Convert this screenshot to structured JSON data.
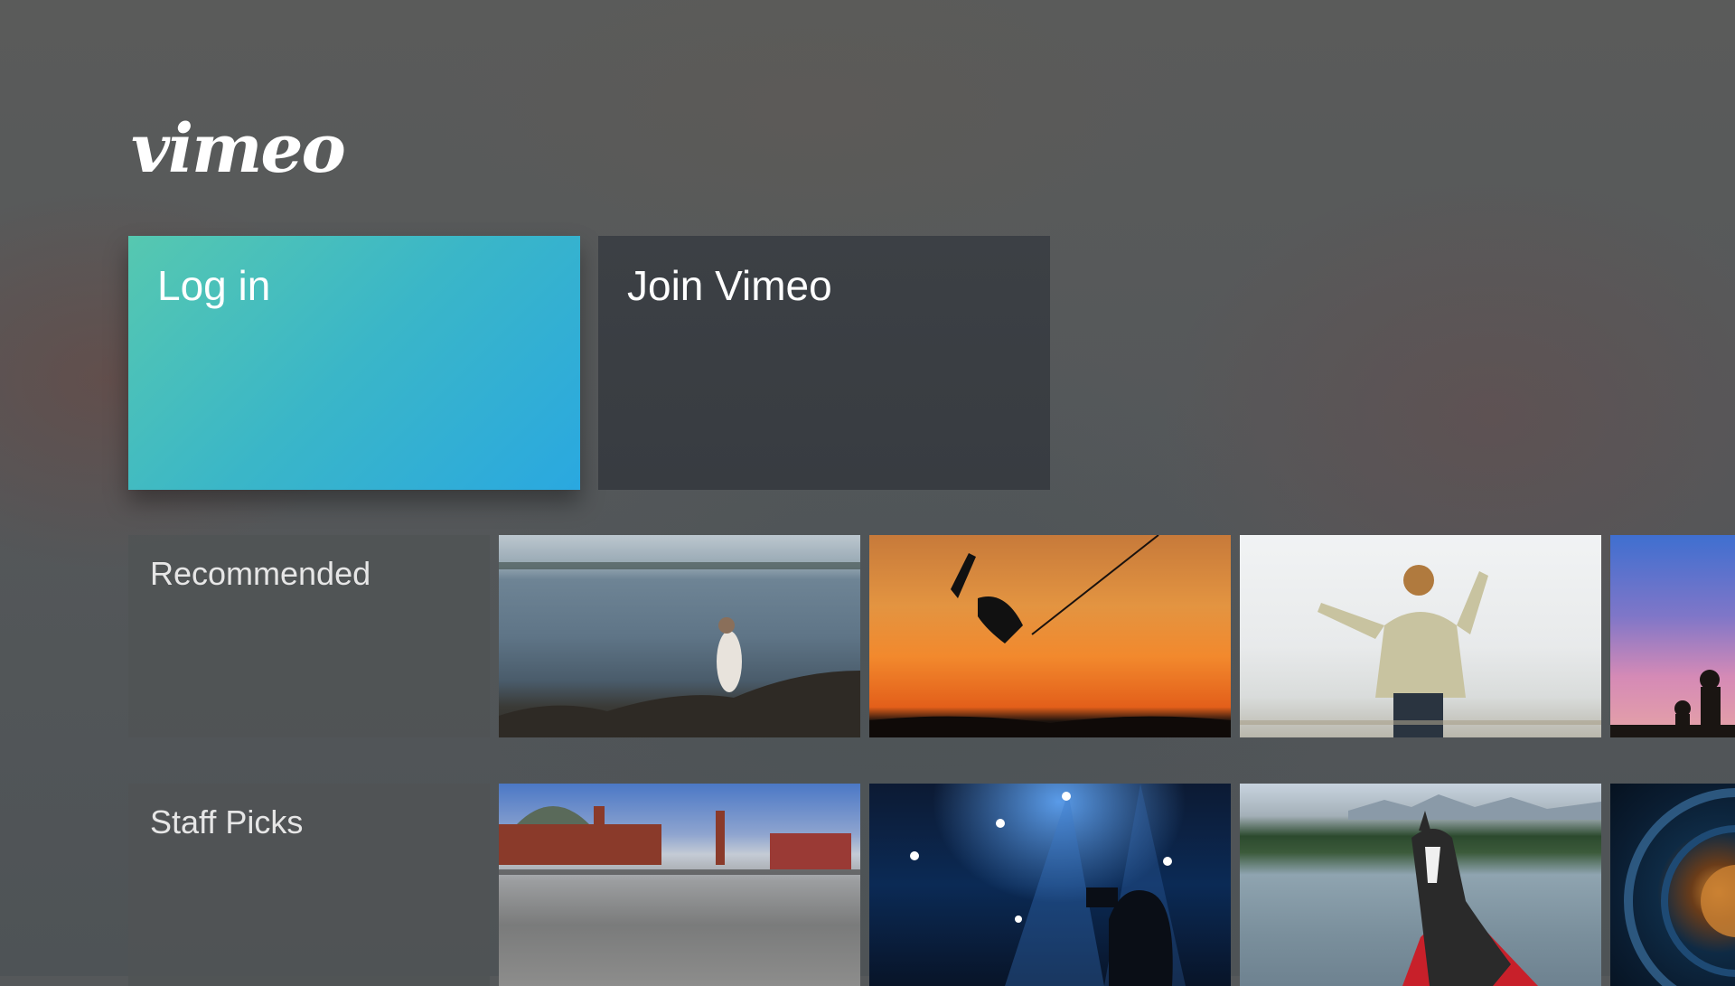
{
  "app": {
    "logo_text": "vimeo"
  },
  "actions": {
    "login_label": "Log in",
    "join_label": "Join Vimeo"
  },
  "rows": [
    {
      "label": "Recommended",
      "thumbnails": [
        {
          "name": "woman-by-sea-thumbnail"
        },
        {
          "name": "wakeboarder-sunset-thumbnail"
        },
        {
          "name": "man-sweater-sky-thumbnail"
        },
        {
          "name": "silhouettes-pink-sky-thumbnail"
        }
      ]
    },
    {
      "label": "Staff Picks",
      "thumbnails": [
        {
          "name": "red-square-thumbnail"
        },
        {
          "name": "stage-lights-camera-thumbnail"
        },
        {
          "name": "dog-lake-thumbnail"
        },
        {
          "name": "camera-lens-thumbnail"
        }
      ]
    }
  ],
  "colors": {
    "login_gradient_start": "#56c8b0",
    "login_gradient_end": "#2aa8e0",
    "join_background": "#3a3e43"
  }
}
